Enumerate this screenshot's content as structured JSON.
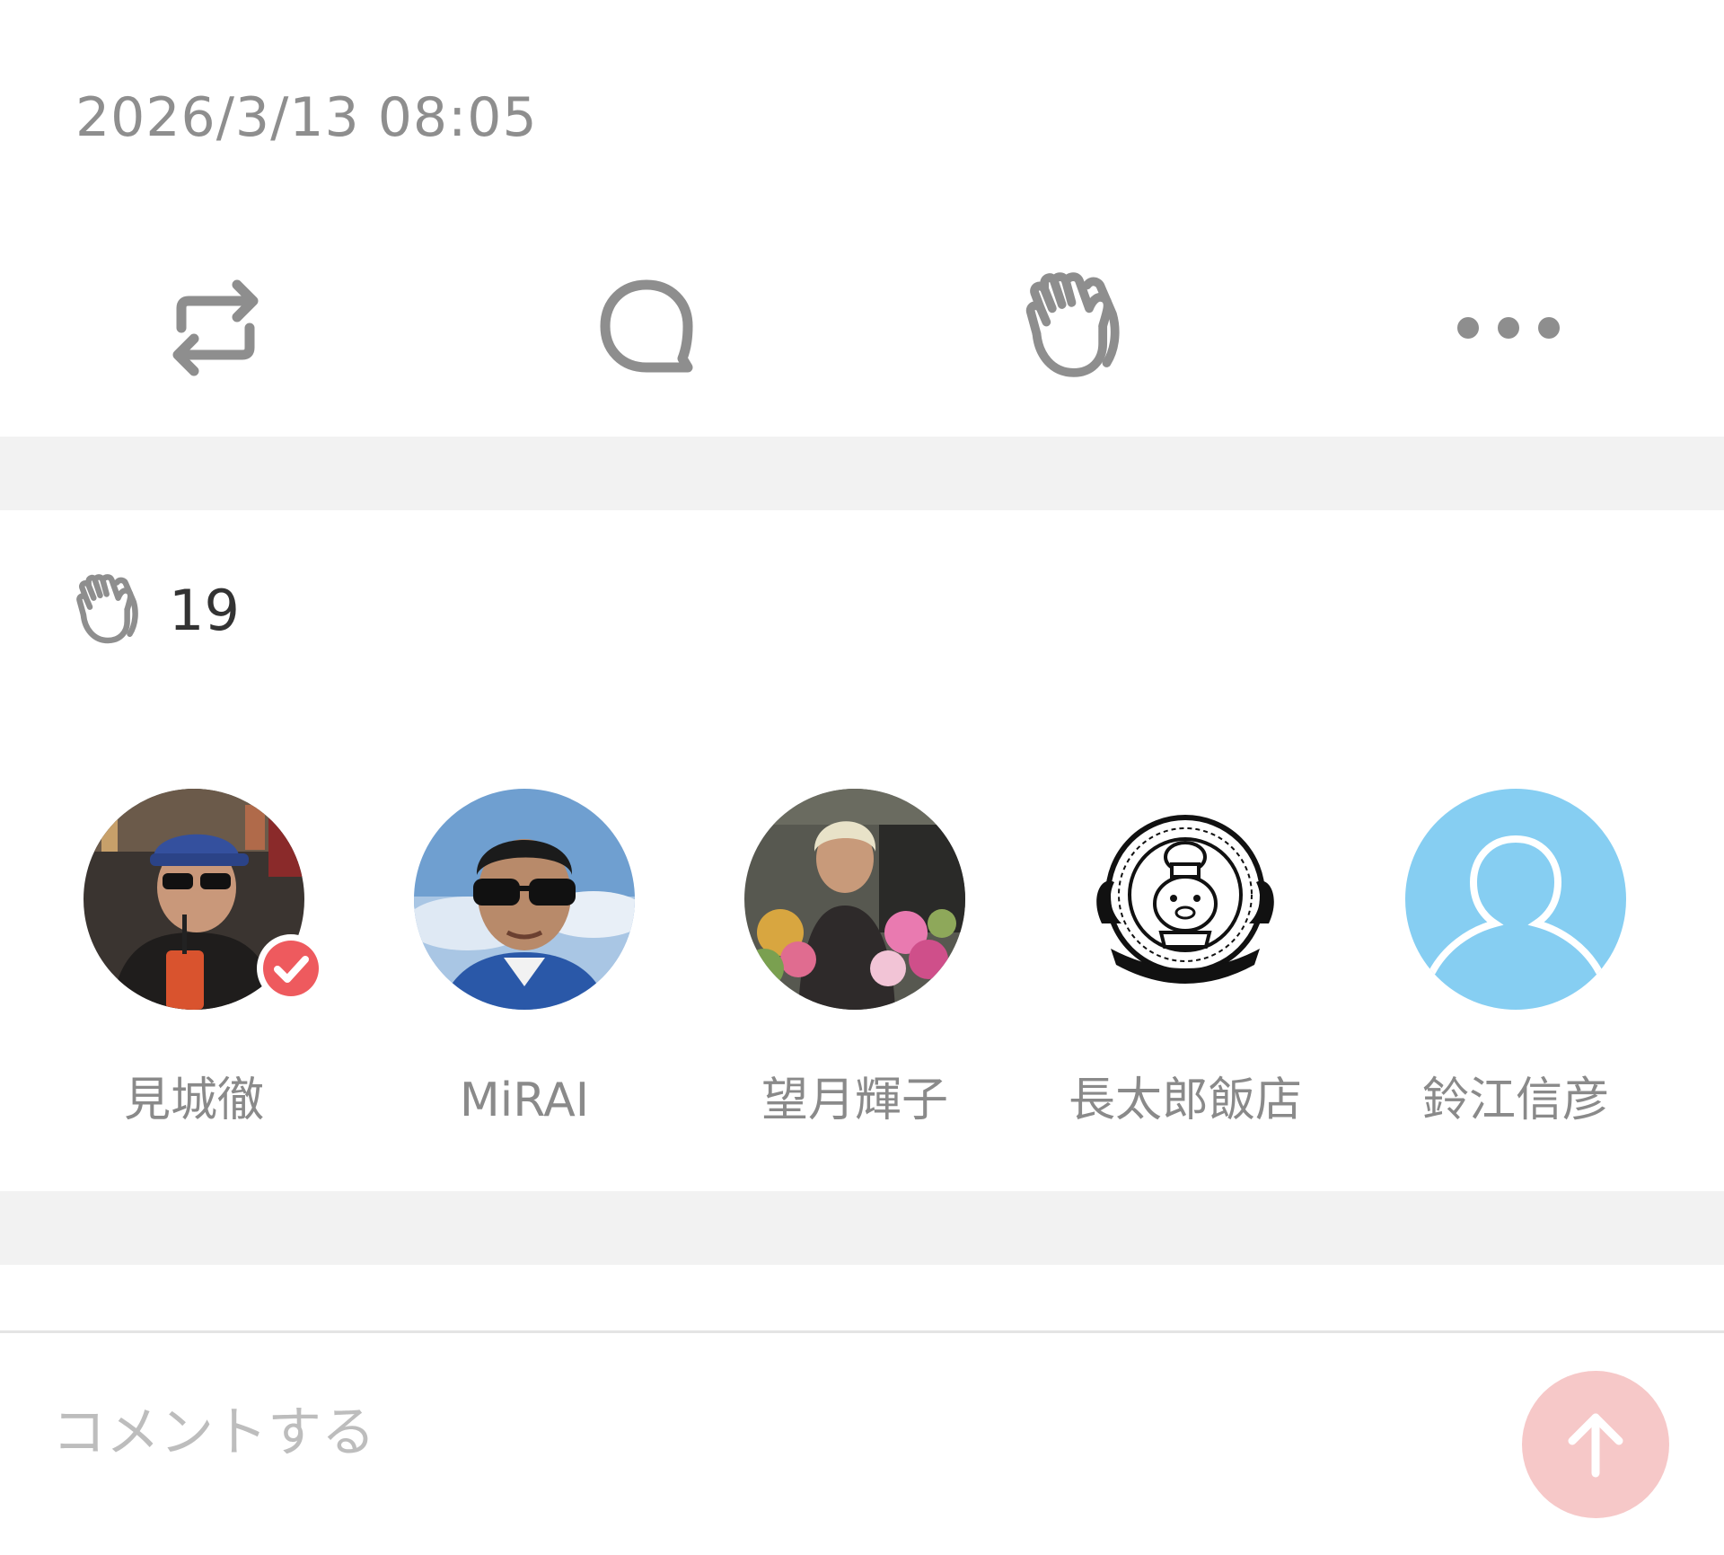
{
  "post": {
    "timestamp": "2026/3/13 08:05"
  },
  "actions": [
    {
      "name": "repost",
      "icon": "repost-icon"
    },
    {
      "name": "comment",
      "icon": "comment-bubble-icon"
    },
    {
      "name": "clap",
      "icon": "clap-hands-icon"
    },
    {
      "name": "more",
      "icon": "more-dots-icon"
    }
  ],
  "claps": {
    "icon": "clap-hands-icon",
    "count": "19"
  },
  "clappers": [
    {
      "name": "見城徹",
      "verified": true
    },
    {
      "name": "MiRAI",
      "verified": false
    },
    {
      "name": "望月輝子",
      "verified": false
    },
    {
      "name": "長太郎飯店",
      "verified": false
    },
    {
      "name": "鈴江信彦",
      "verified": false
    }
  ],
  "comment": {
    "placeholder": "コメントする",
    "value": "",
    "send_icon": "arrow-up-icon"
  },
  "colors": {
    "icon_gray": "#8e8e8e",
    "band_gray": "#f2f2f2",
    "badge_red": "#ee5a5e",
    "send_button": "#f6c8c8",
    "default_avatar_bg": "#86cef2"
  }
}
